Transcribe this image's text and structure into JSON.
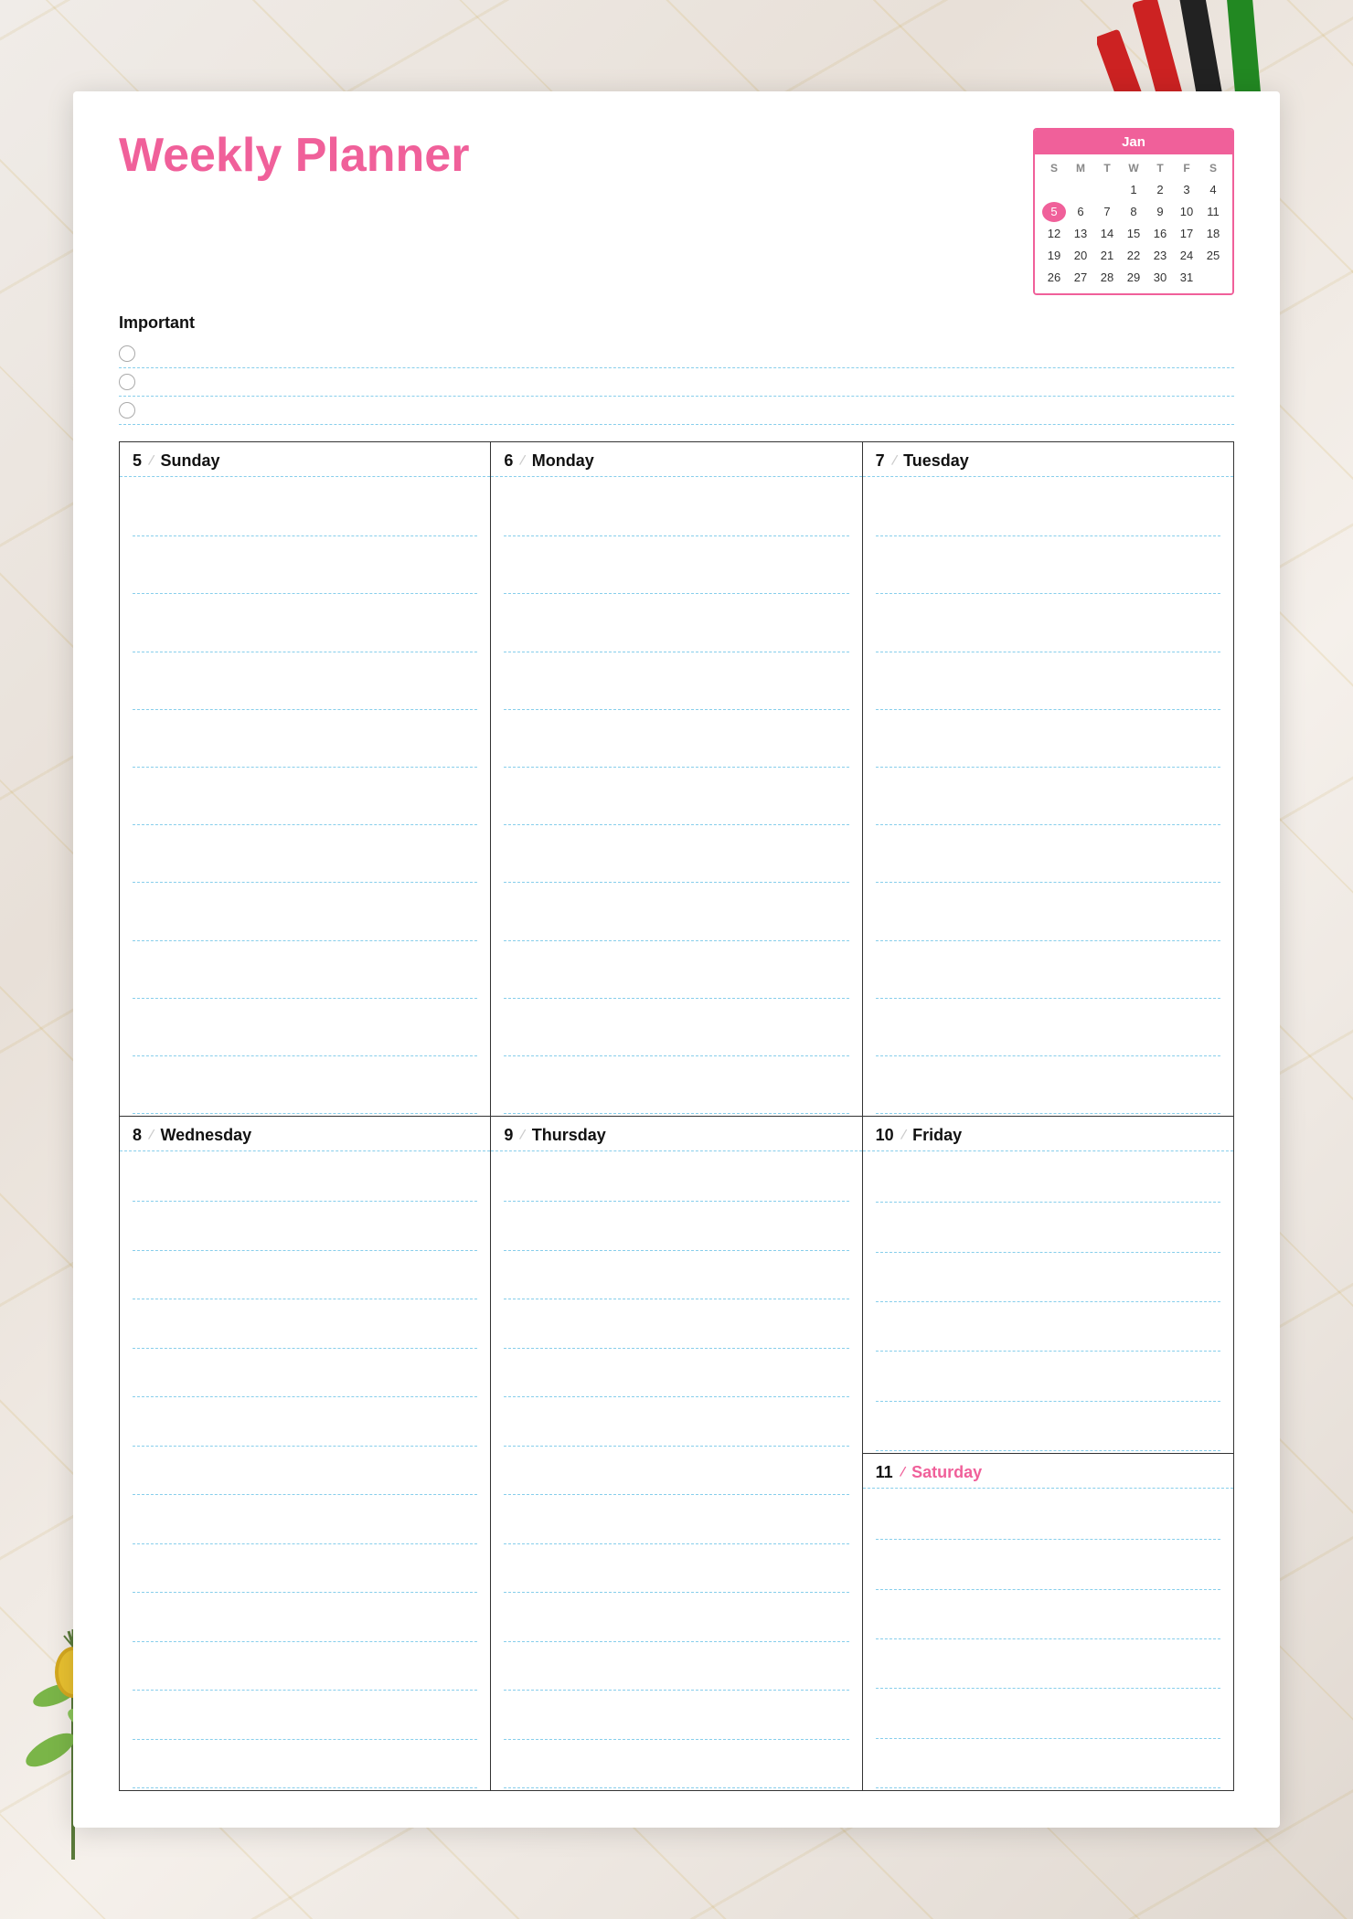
{
  "background": {
    "color": "#e8e0d8"
  },
  "header": {
    "title": "Weekly Planner"
  },
  "calendar": {
    "month": "Jan",
    "days_header": [
      "S",
      "M",
      "T",
      "W",
      "T",
      "F",
      "S"
    ],
    "weeks": [
      [
        "",
        "",
        "",
        "1",
        "2",
        "3",
        "4"
      ],
      [
        "5",
        "6",
        "7",
        "8",
        "9",
        "10",
        "11"
      ],
      [
        "12",
        "13",
        "14",
        "15",
        "16",
        "17",
        "18"
      ],
      [
        "19",
        "20",
        "21",
        "22",
        "23",
        "24",
        "25"
      ],
      [
        "26",
        "27",
        "28",
        "29",
        "30",
        "31",
        ""
      ]
    ],
    "today": "5"
  },
  "important": {
    "label": "Important",
    "lines": 3
  },
  "days": [
    {
      "number": "5",
      "name": "Sunday",
      "color": "normal"
    },
    {
      "number": "6",
      "name": "Monday",
      "color": "normal"
    },
    {
      "number": "7",
      "name": "Tuesday",
      "color": "normal"
    },
    {
      "number": "8",
      "name": "Wednesday",
      "color": "normal"
    },
    {
      "number": "9",
      "name": "Thursday",
      "color": "normal"
    },
    {
      "number": "10",
      "name": "Friday",
      "color": "normal"
    },
    {
      "number": "11",
      "name": "Saturday",
      "color": "pink"
    }
  ],
  "slash": "/",
  "colors": {
    "pink": "#f0609a",
    "dotted_line": "#87ceeb",
    "text": "#111111",
    "border": "#333333"
  }
}
